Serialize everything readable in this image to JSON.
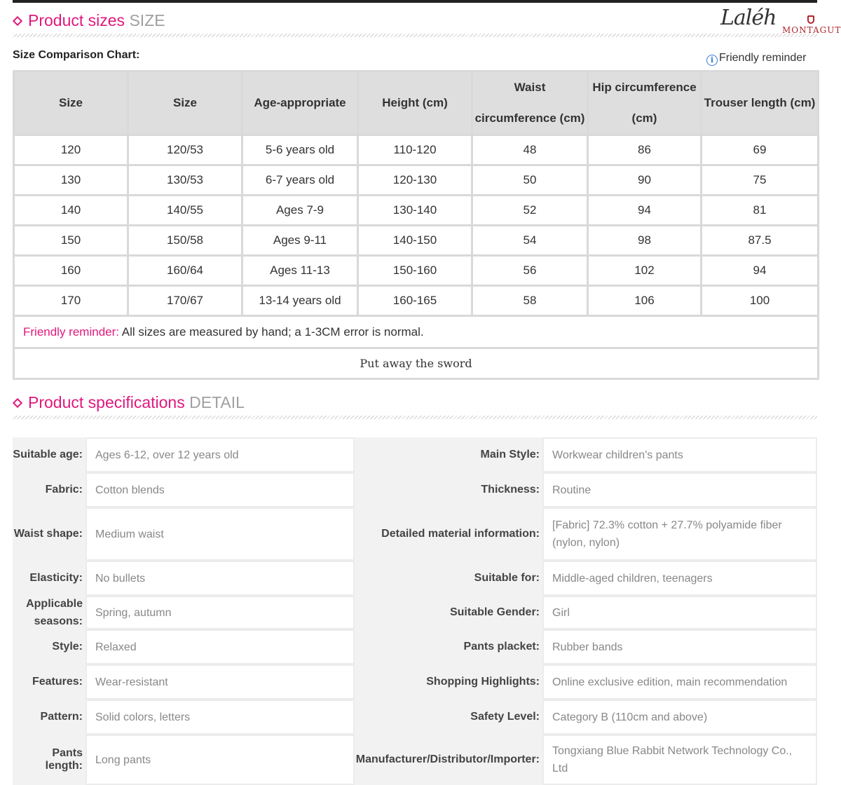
{
  "size_section": {
    "title": "Product sizes",
    "title_en": "SIZE",
    "chart_label": "Size Comparison Chart:",
    "reminder_label": "Friendly reminder",
    "columns": [
      "Size",
      "Size",
      "Age-appropriate",
      "Height (cm)",
      "Waist circumference (cm)",
      "Hip circumference (cm)",
      "Trouser length (cm)"
    ],
    "rows": [
      [
        "120",
        "120/53",
        "5-6 years old",
        "110-120",
        "48",
        "86",
        "69"
      ],
      [
        "130",
        "130/53",
        "6-7 years old",
        "120-130",
        "50",
        "90",
        "75"
      ],
      [
        "140",
        "140/55",
        "Ages 7-9",
        "130-140",
        "52",
        "94",
        "81"
      ],
      [
        "150",
        "150/58",
        "Ages 9-11",
        "140-150",
        "54",
        "98",
        "87.5"
      ],
      [
        "160",
        "160/64",
        "Ages 11-13",
        "150-160",
        "56",
        "102",
        "94"
      ],
      [
        "170",
        "170/67",
        "13-14 years old",
        "160-165",
        "58",
        "106",
        "100"
      ]
    ],
    "note_label": "Friendly reminder:",
    "note_text": " All sizes are measured by hand; a 1-3CM error is normal.",
    "footer": "Put away the sword"
  },
  "logo": {
    "script": "Laléh",
    "brand": "MONTAGUT"
  },
  "spec_section": {
    "title": "Product specifications",
    "title_en": "DETAIL",
    "rows": [
      {
        "l1": "Suitable age:",
        "v1": "Ages 6-12, over 12 years old",
        "l2": "Main Style:",
        "v2": "Workwear children's pants"
      },
      {
        "l1": "Fabric:",
        "v1": "Cotton blends",
        "l2": "Thickness:",
        "v2": "Routine"
      },
      {
        "l1": "Waist shape:",
        "v1": "Medium waist",
        "l2": "Detailed material information:",
        "v2": "[Fabric] 72.3% cotton + 27.7% polyamide fiber (nylon, nylon)"
      },
      {
        "l1": "Elasticity:",
        "v1": "No bullets",
        "l2": "Suitable for:",
        "v2": "Middle-aged children, teenagers"
      },
      {
        "l1": "Applicable seasons:",
        "v1": "Spring, autumn",
        "l2": "Suitable Gender:",
        "v2": "Girl"
      },
      {
        "l1": "Style:",
        "v1": "Relaxed",
        "l2": "Pants placket:",
        "v2": "Rubber bands"
      },
      {
        "l1": "Features:",
        "v1": "Wear-resistant",
        "l2": "Shopping Highlights:",
        "v2": "Online exclusive edition, main recommendation"
      },
      {
        "l1": "Pattern:",
        "v1": "Solid colors, letters",
        "l2": "Safety Level:",
        "v2": "Category B (110cm and above)"
      },
      {
        "l1": "Pants length:",
        "v1": "Long pants",
        "l2": "Manufacturer/Distributor/Importer:",
        "v2": "Tongxiang Blue Rabbit Network Technology Co., Ltd"
      }
    ]
  },
  "colors": {
    "accent": "#e0197d",
    "muted": "#a0a0a0",
    "header_bg": "#dedede",
    "label_bg": "#f2f2f2"
  }
}
